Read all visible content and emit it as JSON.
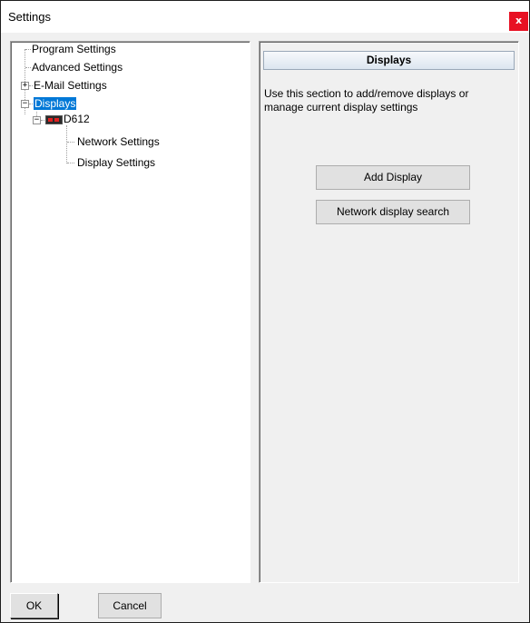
{
  "window": {
    "title": "Settings",
    "close_label": "x"
  },
  "tree": {
    "items": [
      {
        "label": "Program Settings"
      },
      {
        "label": "Advanced Settings"
      },
      {
        "label": "E-Mail Settings",
        "expander": "+"
      },
      {
        "label": "Displays",
        "expander": "−",
        "selected": true
      },
      {
        "label": "D612",
        "expander": "−",
        "icon": "led-display-icon"
      },
      {
        "label": "Network Settings"
      },
      {
        "label": "Display Settings"
      }
    ]
  },
  "panel": {
    "header": "Displays",
    "description": "Use this section to add/remove displays or manage current display settings",
    "add_display_label": "Add Display",
    "network_search_label": "Network display search"
  },
  "footer": {
    "ok_label": "OK",
    "cancel_label": "Cancel"
  },
  "colors": {
    "selection": "#0078d7",
    "close_button": "#e81123",
    "led_red": "#e02020"
  }
}
